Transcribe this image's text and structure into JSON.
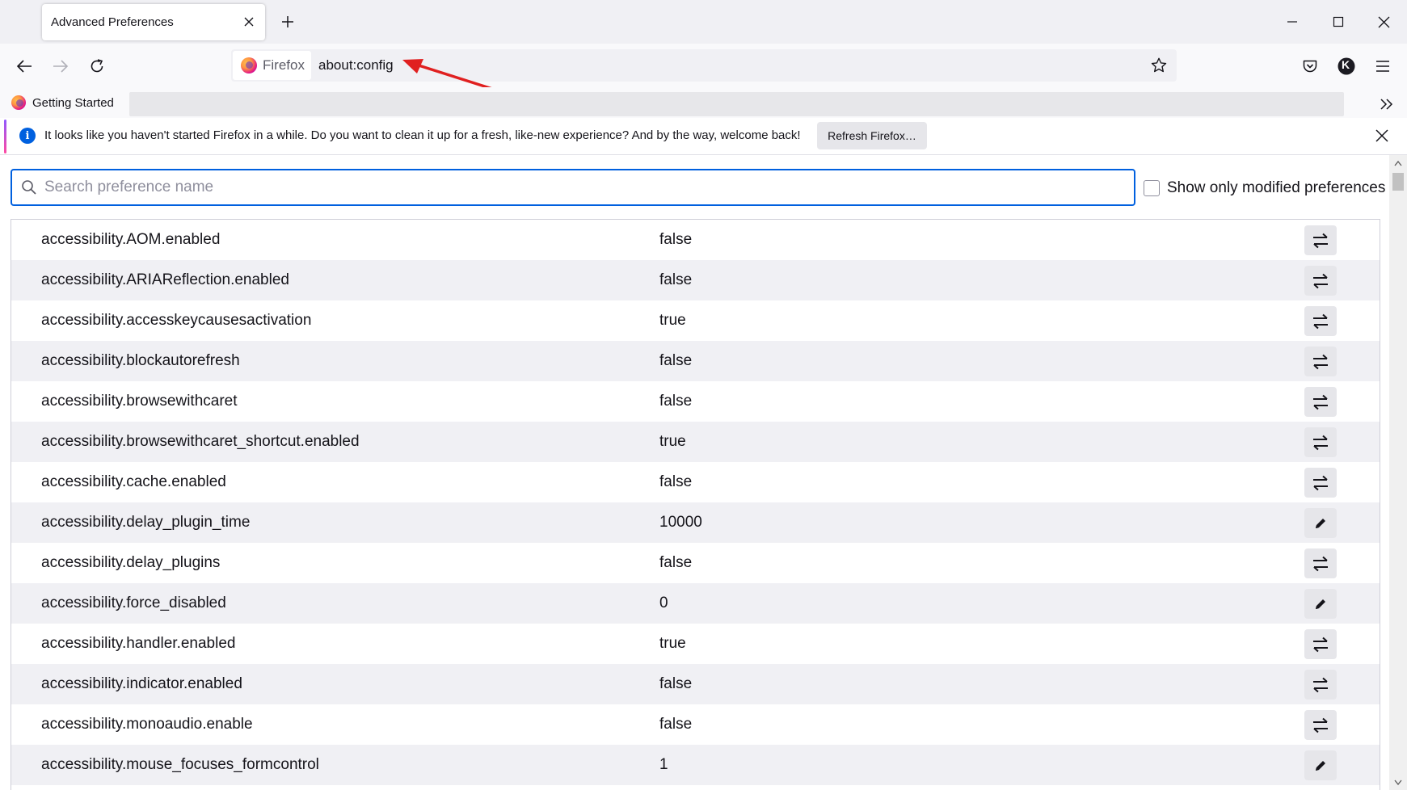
{
  "tab": {
    "title": "Advanced Preferences"
  },
  "urlbar": {
    "identity_label": "Firefox",
    "url": "about:config"
  },
  "bookmarks": {
    "item_label": "Getting Started"
  },
  "notification": {
    "message": "It looks like you haven't started Firefox in a while. Do you want to clean it up for a fresh, like-new experience? And by the way, welcome back!",
    "button_label": "Refresh Firefox…"
  },
  "account_initial": "K",
  "search": {
    "placeholder": "Search preference name",
    "value": ""
  },
  "modified_filter_label": "Show only modified preferences",
  "preferences": [
    {
      "name": "accessibility.AOM.enabled",
      "value": "false",
      "action": "toggle"
    },
    {
      "name": "accessibility.ARIAReflection.enabled",
      "value": "false",
      "action": "toggle"
    },
    {
      "name": "accessibility.accesskeycausesactivation",
      "value": "true",
      "action": "toggle"
    },
    {
      "name": "accessibility.blockautorefresh",
      "value": "false",
      "action": "toggle"
    },
    {
      "name": "accessibility.browsewithcaret",
      "value": "false",
      "action": "toggle"
    },
    {
      "name": "accessibility.browsewithcaret_shortcut.enabled",
      "value": "true",
      "action": "toggle"
    },
    {
      "name": "accessibility.cache.enabled",
      "value": "false",
      "action": "toggle"
    },
    {
      "name": "accessibility.delay_plugin_time",
      "value": "10000",
      "action": "edit"
    },
    {
      "name": "accessibility.delay_plugins",
      "value": "false",
      "action": "toggle"
    },
    {
      "name": "accessibility.force_disabled",
      "value": "0",
      "action": "edit"
    },
    {
      "name": "accessibility.handler.enabled",
      "value": "true",
      "action": "toggle"
    },
    {
      "name": "accessibility.indicator.enabled",
      "value": "false",
      "action": "toggle"
    },
    {
      "name": "accessibility.monoaudio.enable",
      "value": "false",
      "action": "toggle"
    },
    {
      "name": "accessibility.mouse_focuses_formcontrol",
      "value": "1",
      "action": "edit"
    }
  ],
  "colors": {
    "accent": "#0060df",
    "annotation_arrow": "#e02020"
  }
}
